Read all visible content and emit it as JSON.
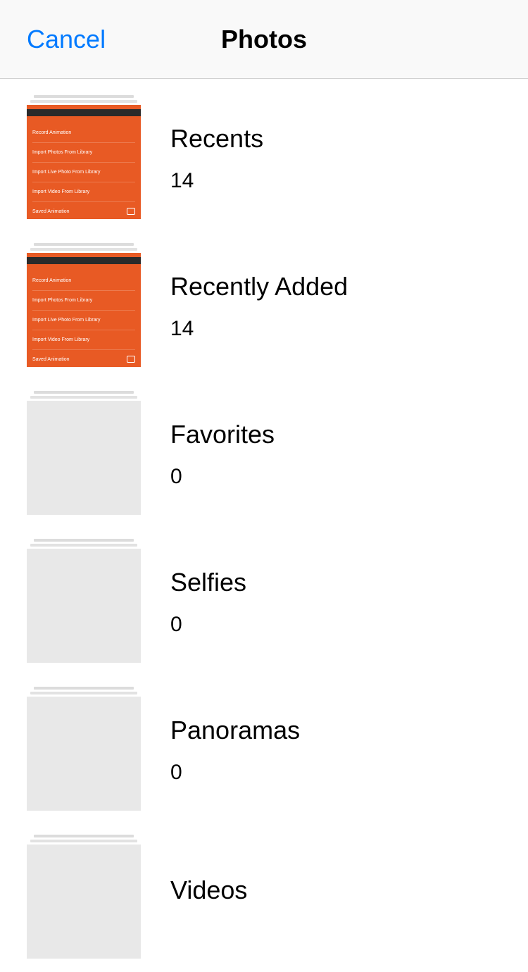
{
  "header": {
    "cancel_label": "Cancel",
    "title": "Photos"
  },
  "albums": [
    {
      "name": "Recents",
      "count": "14",
      "thumb_style": "orange"
    },
    {
      "name": "Recently Added",
      "count": "14",
      "thumb_style": "orange"
    },
    {
      "name": "Favorites",
      "count": "0",
      "thumb_style": "empty"
    },
    {
      "name": "Selfies",
      "count": "0",
      "thumb_style": "empty"
    },
    {
      "name": "Panoramas",
      "count": "0",
      "thumb_style": "empty"
    },
    {
      "name": "Videos",
      "count": "",
      "thumb_style": "empty"
    }
  ],
  "thumb_lines": [
    "Record Animation",
    "Import Photos From Library",
    "Import Live Photo From Library",
    "Import Video From Library",
    "Saved Animation"
  ]
}
